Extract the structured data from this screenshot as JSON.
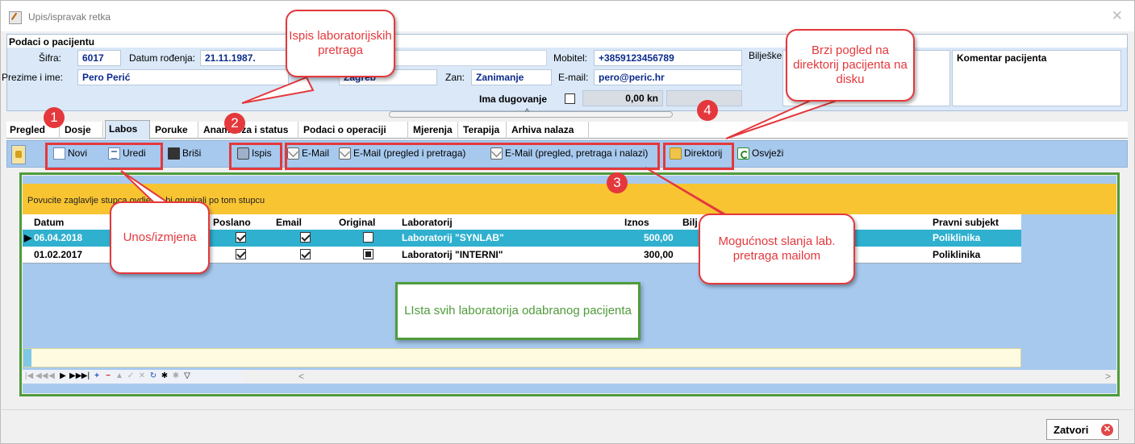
{
  "window": {
    "title": "Upis/ispravak retka",
    "close_glyph": "✕"
  },
  "patient": {
    "section_title": "Podaci o pacijentu",
    "sifra_label": "Šifra:",
    "sifra": "6017",
    "dob_label": "Datum rođenja:",
    "dob": "21.11.1987.",
    "mobitel_label": "Mobitel:",
    "mobitel": "+3859123456789",
    "biljeske_label": "Bilješke:",
    "ime_label": "Prezime i ime:",
    "ime": "Pero Perić",
    "mjesto": "Zagreb",
    "zan_label": "Zan:",
    "zan": "Zanimanje",
    "email_label": "E-mail:",
    "email": "pero@peric.hr",
    "dug_label": "Ima dugovanje",
    "dug_amount": "0,00 kn",
    "komentar": "Komentar pacijenta"
  },
  "tabs": [
    "Pregled",
    "Dosje",
    "Labos",
    "Poruke",
    "Anamneza i status",
    "Podaci o operaciji",
    "Mjerenja",
    "Terapija",
    "Arhiva nalaza"
  ],
  "toolbar": {
    "novi": "Novi",
    "uredi": "Uredi",
    "brisi": "Briši",
    "ispis": "Ispis",
    "email": "E-Mail",
    "email_pp": "E-Mail (pregled i pretraga)",
    "email_ppn": "E-Mail (pregled, pretraga i nalazi)",
    "direktorij": "Direktorij",
    "osvjezi": "Osvježi"
  },
  "grid": {
    "group_hint": "Povucite zaglavlje stupca ovdje da bi grupirali po tom stupcu",
    "columns": {
      "datum": "Datum",
      "poslano": "Poslano",
      "email": "Email",
      "original": "Original",
      "laboratorij": "Laboratorij",
      "iznos": "Iznos",
      "biljeske": "Bilj",
      "pravni": "Pravni subjekt"
    },
    "rows": [
      {
        "datum": "06.04.2018",
        "poslano": true,
        "email": true,
        "original": "empty",
        "laboratorij": "Laboratorij \"SYNLAB\"",
        "iznos": "500,00",
        "pravni": "Poliklinika"
      },
      {
        "datum": "01.02.2017",
        "poslano": true,
        "email": true,
        "original": "filled",
        "laboratorij": "Laboratorij \"INTERNI\"",
        "iznos": "300,00",
        "pravni": "Poliklinika"
      }
    ],
    "nav_glyphs": [
      "|◀",
      "◀◀",
      "◀",
      "▶",
      "▶▶",
      "▶|",
      "+",
      "−",
      "▲",
      "✓",
      "✕",
      "↻",
      "✱",
      "✱",
      "▽"
    ]
  },
  "close_button": "Zatvori",
  "annotations": {
    "badge1": "1",
    "badge2": "2",
    "badge3": "3",
    "badge4": "4",
    "ispis": "Ispis laboratorijskih pretraga",
    "unos": "Unos/izmjena",
    "brzi": "Brzi pogled na direktorij pacijenta na disku",
    "mail": "Mogućnost slanja lab. pretraga mailom",
    "lista": "LIsta svih laboratorija odabranog pacijenta"
  },
  "colors": {
    "accent_red": "#e4383c",
    "accent_green": "#4f9b3a",
    "selected_row": "#2fb0cf",
    "group_bar": "#f9c432",
    "toolbar": "#a7c9ee"
  }
}
